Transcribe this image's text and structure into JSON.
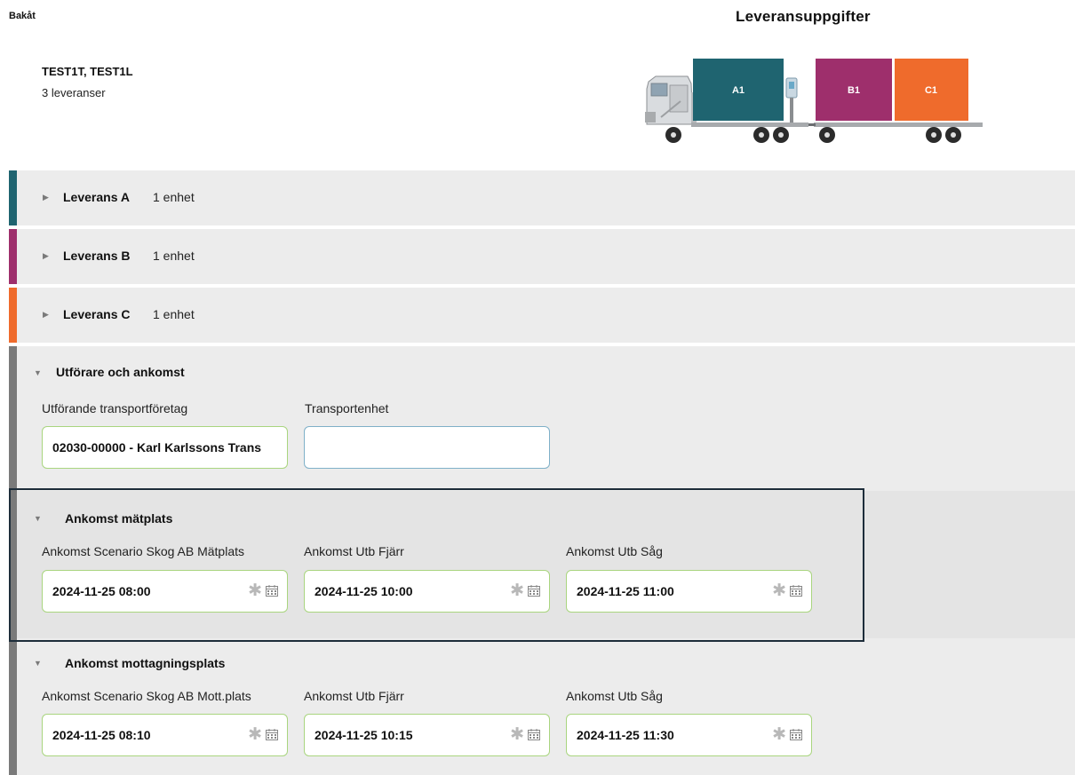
{
  "header": {
    "back_label": "Bakåt",
    "title": "Leveransuppgifter",
    "vehicle_name": "TEST1T, TEST1L",
    "delivery_count": "3 leveranser"
  },
  "truck": {
    "containers": [
      {
        "label": "A1",
        "color": "#1f6470"
      },
      {
        "label": "B1",
        "color": "#9e2f6c"
      },
      {
        "label": "C1",
        "color": "#ef6b2c"
      }
    ]
  },
  "deliveries": [
    {
      "title": "Leverans A",
      "units": "1 enhet",
      "color": "#1f6470"
    },
    {
      "title": "Leverans B",
      "units": "1 enhet",
      "color": "#9e2f6c"
    },
    {
      "title": "Leverans C",
      "units": "1 enhet",
      "color": "#ef6b2c"
    }
  ],
  "performer_section": {
    "title": "Utförare och ankomst",
    "carrier_label": "Utförande transportföretag",
    "carrier_value": "02030-00000 - Karl Karlssons Trans",
    "unit_label": "Transportenhet",
    "unit_value": ""
  },
  "arrival_measure": {
    "title": "Ankomst mätplats",
    "fields": [
      {
        "label": "Ankomst Scenario Skog AB Mätplats",
        "value": "2024-11-25 08:00"
      },
      {
        "label": "Ankomst Utb Fjärr",
        "value": "2024-11-25 10:00"
      },
      {
        "label": "Ankomst Utb Såg",
        "value": "2024-11-25 11:00"
      }
    ]
  },
  "arrival_receive": {
    "title": "Ankomst mottagningsplats",
    "fields": [
      {
        "label": "Ankomst Scenario Skog AB Mott.plats",
        "value": "2024-11-25 08:10"
      },
      {
        "label": "Ankomst Utb Fjärr",
        "value": "2024-11-25 10:15"
      },
      {
        "label": "Ankomst Utb Såg",
        "value": "2024-11-25 11:30"
      }
    ]
  },
  "colors": {
    "section_bg": "#ececec",
    "section_accent": "#7a7a7a",
    "field_border": "#a9d57f"
  }
}
